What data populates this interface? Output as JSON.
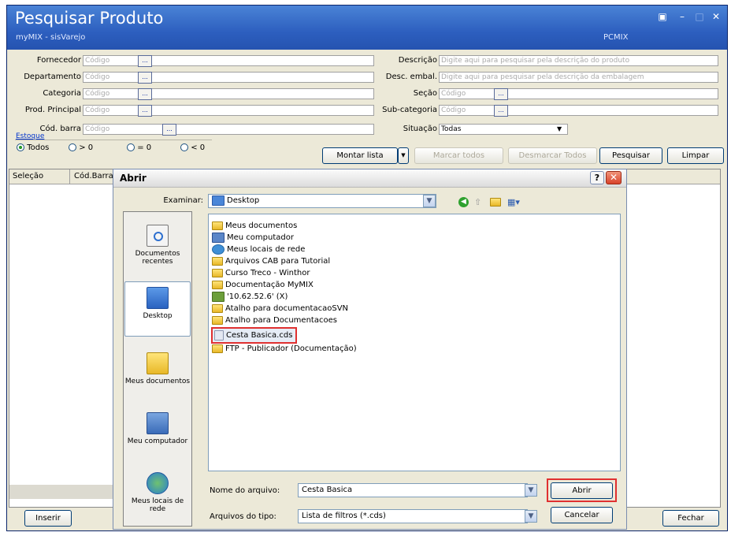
{
  "window": {
    "title": "Pesquisar Produto",
    "subtitle": "myMIX - sisVarejo",
    "right_caption": "PCMIX"
  },
  "filters": {
    "fornecedor": {
      "label": "Fornecedor",
      "placeholder": "Código"
    },
    "departamento": {
      "label": "Departamento",
      "placeholder": "Código"
    },
    "categoria": {
      "label": "Categoria",
      "placeholder": "Código"
    },
    "prod_principal": {
      "label": "Prod. Principal",
      "placeholder": "Código"
    },
    "cod_barra": {
      "label": "Cód. barra",
      "placeholder": "Código"
    },
    "descricao": {
      "label": "Descrição",
      "placeholder": "Digite aqui para pesquisar pela descrição do produto"
    },
    "desc_embal": {
      "label": "Desc. embal.",
      "placeholder": "Digite aqui para pesquisar pela descrição da embalagem"
    },
    "secao": {
      "label": "Seção",
      "placeholder": "Código"
    },
    "sub_categoria": {
      "label": "Sub-categoria",
      "placeholder": "Código"
    },
    "situacao": {
      "label": "Situação",
      "value": "Todas"
    },
    "dots": "...",
    "estoque": {
      "label": "Estoque",
      "options": [
        "Todos",
        "> 0",
        "= 0",
        "< 0"
      ],
      "selected": "Todos"
    }
  },
  "toolbar": {
    "montar_lista": "Montar lista",
    "marcar_todos": "Marcar todos",
    "desmarcar_todos": "Desmarcar Todos",
    "pesquisar": "Pesquisar",
    "limpar": "Limpar"
  },
  "grid": {
    "columns": [
      "Seleção",
      "Cód.Barra"
    ]
  },
  "bottom": {
    "inserir": "Inserir",
    "fechar": "Fechar"
  },
  "dialog": {
    "title": "Abrir",
    "examinar_label": "Examinar:",
    "examinar_value": "Desktop",
    "help": "?",
    "places": [
      {
        "label": "Documentos recentes",
        "icon": "recent-documents-icon"
      },
      {
        "label": "Desktop",
        "icon": "desktop-icon"
      },
      {
        "label": "Meus documentos",
        "icon": "my-documents-icon"
      },
      {
        "label": "Meu computador",
        "icon": "my-computer-icon"
      },
      {
        "label": "Meus locais de rede",
        "icon": "network-places-icon"
      }
    ],
    "files": [
      {
        "name": "Meus documentos",
        "icon": "my-documents-icon"
      },
      {
        "name": "Meu computador",
        "icon": "my-computer-icon"
      },
      {
        "name": "Meus locais de rede",
        "icon": "network-places-icon"
      },
      {
        "name": "Arquivos CAB para Tutorial",
        "icon": "folder-icon"
      },
      {
        "name": "Curso Treco - Winthor",
        "icon": "folder-icon"
      },
      {
        "name": "Documentação MyMIX",
        "icon": "folder-icon"
      },
      {
        "name": "'10.62.52.6' (X)",
        "icon": "network-drive-icon"
      },
      {
        "name": "Atalho para documentacaoSVN",
        "icon": "folder-shortcut-icon"
      },
      {
        "name": "Atalho para Documentacoes",
        "icon": "folder-shortcut-icon"
      },
      {
        "name": "Cesta Basica.cds",
        "icon": "cds-file-icon",
        "selected": true
      },
      {
        "name": "FTP - Publicador (Documentação)",
        "icon": "ftp-folder-icon"
      }
    ],
    "filename_label": "Nome do arquivo:",
    "filename_value": "Cesta Basica",
    "filetype_label": "Arquivos do tipo:",
    "filetype_value": "Lista de filtros (*.cds)",
    "open_button": "Abrir",
    "cancel_button": "Cancelar"
  }
}
